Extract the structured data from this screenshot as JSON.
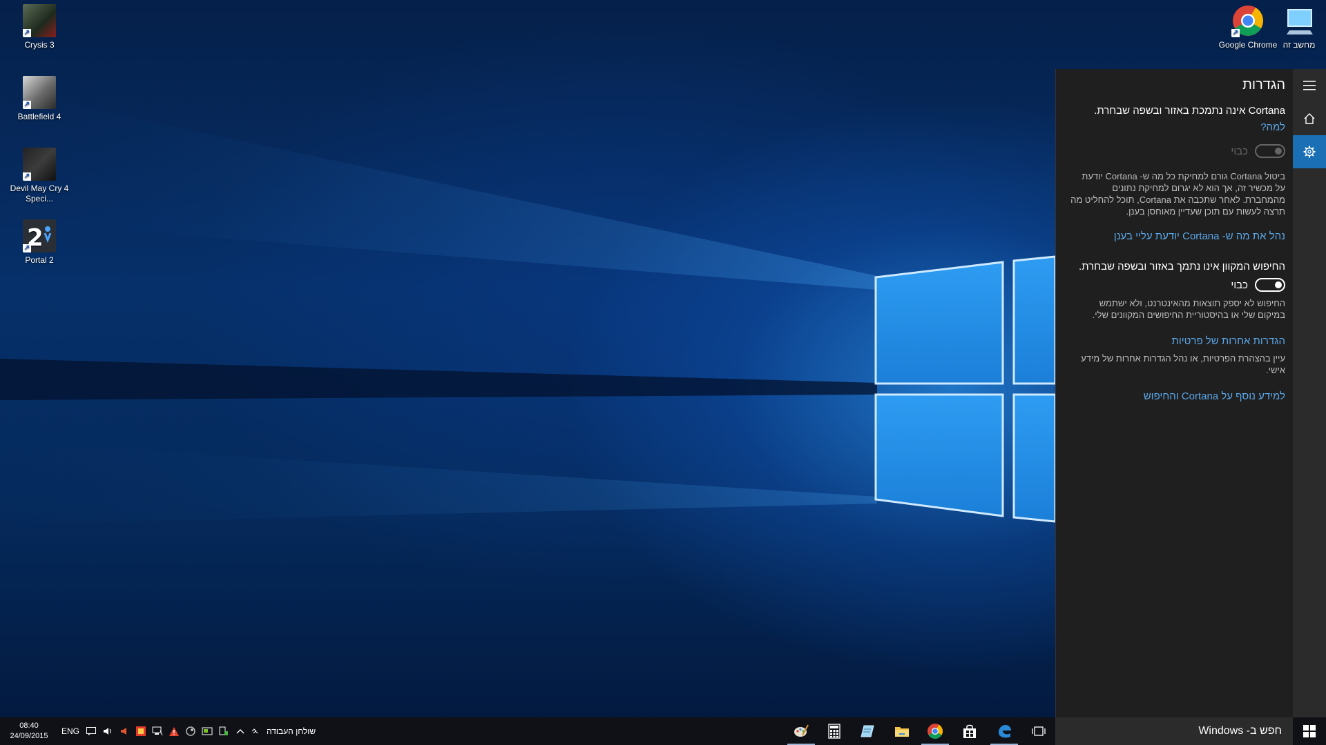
{
  "desktop": {
    "icons_left": [
      {
        "label": "Crysis 3"
      },
      {
        "label": "Battlefield 4"
      },
      {
        "label": "Devil May Cry 4 Speci..."
      },
      {
        "label": "Portal 2"
      }
    ],
    "icons_right": [
      {
        "label": "Google Chrome"
      },
      {
        "label": "מחשב זה"
      }
    ]
  },
  "cortana": {
    "title": "הגדרות",
    "section1": {
      "heading": "Cortana אינה נתמכת באזור ובשפה שבחרת.",
      "why_link": "למה?",
      "toggle_label": "כבוי",
      "description": "ביטול Cortana גורם למחיקת כל מה ש- Cortana יודעת על מכשיר זה, אך הוא לא יגרום למחיקת נתונים מהמחברת. לאחר שתכבה את Cortana, תוכל להחליט מה תרצה לעשות עם תוכן שעדיין מאוחסן בענן.",
      "manage_link": "נהל את מה ש- Cortana יודעת עליי בענן"
    },
    "section2": {
      "heading": "החיפוש המקוון אינו נתמך באזור ובשפה שבחרת.",
      "toggle_label": "כבוי",
      "description": "החיפוש לא יספק תוצאות מהאינטרנט, ולא ישתמש במיקום שלי או בהיסטוריית החיפושים המקוונים שלי."
    },
    "section3": {
      "privacy_link": "הגדרות אחרות של פרטיות",
      "privacy_desc": "עיין בהצהרת הפרטיות, או נהל הגדרות אחרות של מידע אישי."
    },
    "learn_more_link": "למידע נוסף על Cortana והחיפוש"
  },
  "taskbar": {
    "search_placeholder": "חפש ב- Windows",
    "toolbar_label": "שולחן העבודה",
    "language": "ENG",
    "time": "08:40",
    "date": "24/09/2015"
  },
  "colors": {
    "accent": "#1a6fb5",
    "link": "#5aa7e8",
    "panel_bg": "#1f1f1f",
    "taskbar_bg": "#0f1116"
  }
}
